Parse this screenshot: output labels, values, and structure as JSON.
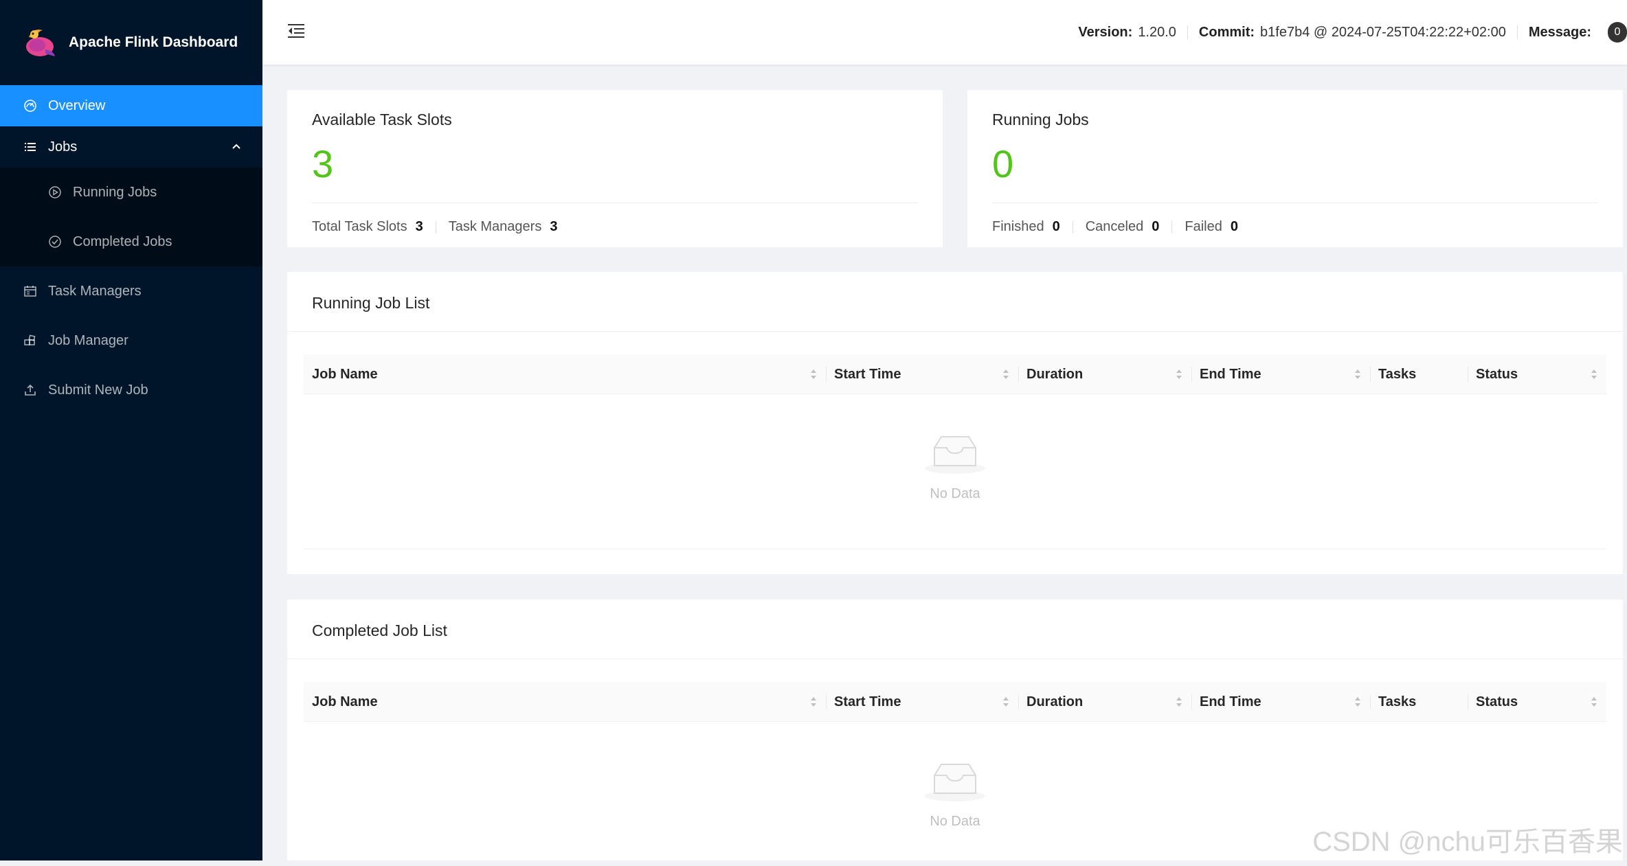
{
  "app": {
    "title": "Apache Flink Dashboard"
  },
  "sidebar": {
    "items": [
      {
        "label": "Overview",
        "icon": "dashboard-icon",
        "active": true
      },
      {
        "label": "Jobs",
        "icon": "list-icon",
        "expanded": true,
        "children": [
          {
            "label": "Running Jobs",
            "icon": "play-circle-icon"
          },
          {
            "label": "Completed Jobs",
            "icon": "check-circle-icon"
          }
        ]
      },
      {
        "label": "Task Managers",
        "icon": "schedule-icon"
      },
      {
        "label": "Job Manager",
        "icon": "build-icon"
      },
      {
        "label": "Submit New Job",
        "icon": "upload-icon"
      }
    ]
  },
  "header": {
    "version_label": "Version:",
    "version": "1.20.0",
    "commit_label": "Commit:",
    "commit": "b1fe7b4 @ 2024-07-25T04:22:22+02:00",
    "message_label": "Message:",
    "message_count": "0"
  },
  "slots": {
    "title": "Available Task Slots",
    "value": "3",
    "total_label": "Total Task Slots",
    "total_value": "3",
    "tm_label": "Task Managers",
    "tm_value": "3"
  },
  "running": {
    "title": "Running Jobs",
    "value": "0",
    "finished_label": "Finished",
    "finished_value": "0",
    "canceled_label": "Canceled",
    "canceled_value": "0",
    "failed_label": "Failed",
    "failed_value": "0"
  },
  "running_list": {
    "title": "Running Job List",
    "columns": [
      "Job Name",
      "Start Time",
      "Duration",
      "End Time",
      "Tasks",
      "Status"
    ],
    "empty_text": "No Data"
  },
  "completed_list": {
    "title": "Completed Job List",
    "columns": [
      "Job Name",
      "Start Time",
      "Duration",
      "End Time",
      "Tasks",
      "Status"
    ],
    "empty_text": "No Data"
  },
  "watermark": "CSDN @nchu可乐百香果",
  "colors": {
    "sidebar": "#001529",
    "active": "#1890ff",
    "stat": "#52c41a"
  }
}
